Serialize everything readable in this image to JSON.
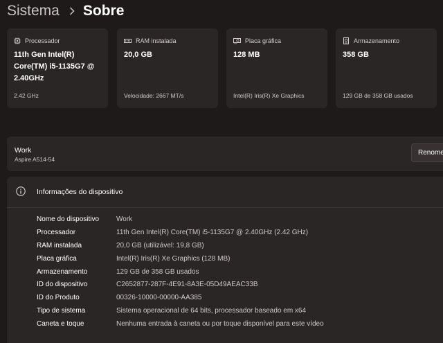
{
  "breadcrumb": {
    "parent": "Sistema",
    "current": "Sobre"
  },
  "cards": [
    {
      "icon": "processor-icon",
      "label": "Processador",
      "value": "11th Gen Intel(R) Core(TM) i5-1135G7 @ 2.40GHz",
      "sub": "2.42 GHz"
    },
    {
      "icon": "ram-icon",
      "label": "RAM instalada",
      "value": "20,0 GB",
      "sub": "Velocidade: 2667 MT/s"
    },
    {
      "icon": "graphics-card-icon",
      "label": "Placa gráfica",
      "value": "128 MB",
      "sub": "Intel(R) Iris(R) Xe Graphics"
    },
    {
      "icon": "storage-icon",
      "label": "Armazenamento",
      "value": "358 GB",
      "sub": "129 GB de 358 GB usados"
    }
  ],
  "device": {
    "name": "Work",
    "model": "Aspire A514-54",
    "rename_label": "Renomear este PC"
  },
  "specs": {
    "title": "Informações do dispositivo",
    "rows": [
      {
        "key": "Nome do dispositivo",
        "value": "Work"
      },
      {
        "key": "Processador",
        "value": "11th Gen Intel(R) Core(TM) i5-1135G7 @ 2.40GHz (2.42 GHz)"
      },
      {
        "key": "RAM instalada",
        "value": "20,0 GB (utilizável: 19,8 GB)"
      },
      {
        "key": "Placa gráfica",
        "value": "Intel(R) Iris(R) Xe Graphics (128 MB)"
      },
      {
        "key": "Armazenamento",
        "value": "129 GB de 358 GB usados"
      },
      {
        "key": "ID do dispositivo",
        "value": "C2652877-287F-4E91-8A3E-05D49AEAC33B"
      },
      {
        "key": "ID do Produto",
        "value": "00326-10000-00000-AA385"
      },
      {
        "key": "Tipo de sistema",
        "value": "Sistema operacional de 64 bits, processador baseado em x64"
      },
      {
        "key": "Caneta e toque",
        "value": "Nenhuma entrada à caneta ou por toque disponível para este vídeo"
      }
    ]
  }
}
